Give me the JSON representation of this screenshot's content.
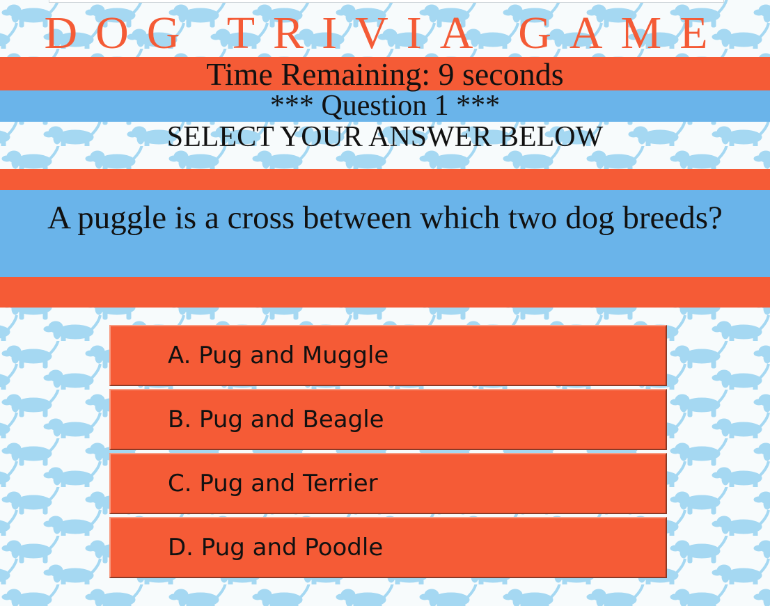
{
  "page": {
    "title": "DOG TRIVIA GAME",
    "timer_text": "Time Remaining: 9 seconds",
    "question_number_text": "*** Question 1 ***",
    "instruction": "SELECT YOUR ANSWER BELOW"
  },
  "question": {
    "text": "A puggle is a cross between which two dog breeds?"
  },
  "answers": [
    {
      "label": "A. Pug and Muggle"
    },
    {
      "label": "B. Pug and Beagle"
    },
    {
      "label": "C. Pug and Terrier"
    },
    {
      "label": "D. Pug and Poodle"
    }
  ],
  "colors": {
    "accent_orange": "#f55b36",
    "accent_blue": "#6ab4ea",
    "pattern_blue": "#a5d8f2",
    "background": "#f7fbfc"
  },
  "background_pattern": {
    "icon": "dachshund-silhouette-icon"
  }
}
